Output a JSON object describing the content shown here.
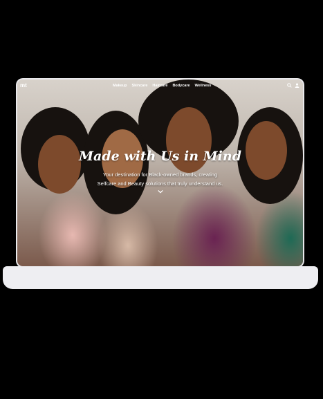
{
  "nav": {
    "logo": "mt",
    "links": [
      "Makeup",
      "Skincare",
      "Haircare",
      "Bodycare",
      "Wellness"
    ],
    "icons": [
      "search-icon",
      "user-icon"
    ]
  },
  "hero": {
    "title": "Made with Us in Mind",
    "subtitle_line1": "Your destination for Black-owned brands, creating",
    "subtitle_line2": "Selfcare and Beauty solutions that truly understand us."
  },
  "colors": {
    "background": "#000000",
    "text": "#ffffff",
    "device": "#eeeef2"
  }
}
